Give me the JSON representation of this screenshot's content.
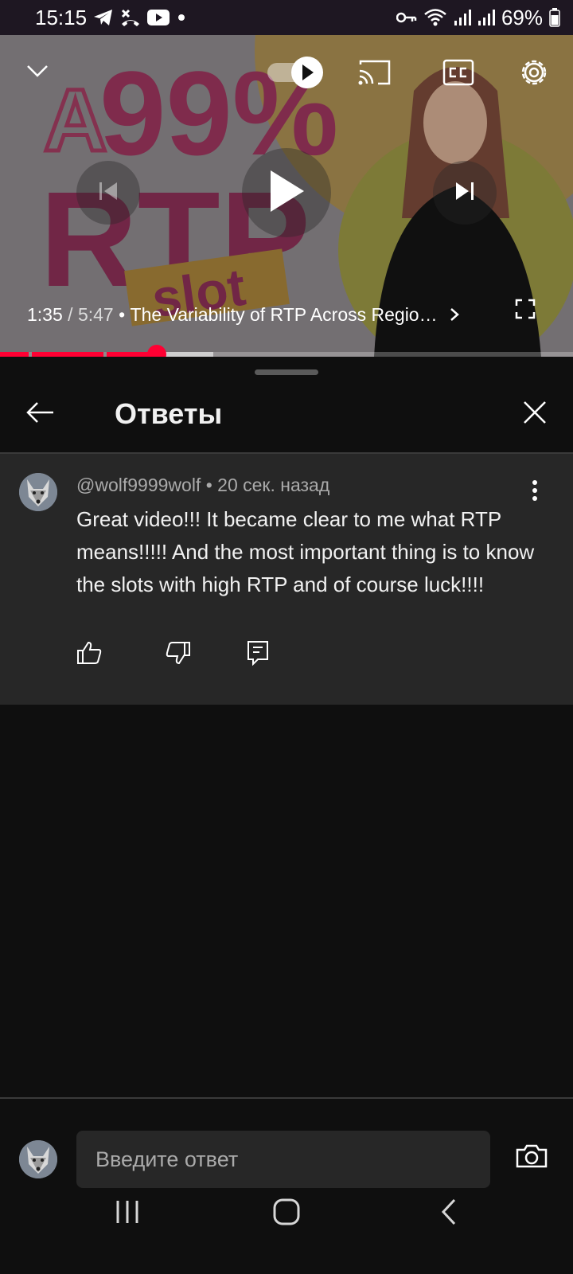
{
  "status_bar": {
    "time": "15:15",
    "battery": "69%",
    "icons": [
      "telegram-icon",
      "missed-call-icon",
      "youtube-icon",
      "dot-icon",
      "vpn-key-icon",
      "wifi-icon",
      "signal-icon",
      "signal-icon",
      "battery-icon"
    ]
  },
  "player": {
    "current_time": "1:35",
    "separator": " / ",
    "duration": "5:47",
    "dot": " • ",
    "chapter": "The Variability of RTP Across Regio…",
    "progress_played": 0.273,
    "progress_buffered": 0.372,
    "icons": [
      "collapse-chevron-icon",
      "autoplay-toggle-icon",
      "cast-icon",
      "captions-icon",
      "settings-gear-icon",
      "previous-icon",
      "play-icon",
      "next-icon",
      "chapter-chevron-icon",
      "fullscreen-icon"
    ],
    "thumbnail_text": [
      "A",
      "99%",
      "RTP",
      "slot"
    ]
  },
  "panel": {
    "title": "Ответы"
  },
  "comment": {
    "author": "@wolf9999wolf",
    "time": "20 сек. назад",
    "meta_sep": " • ",
    "text": "Great video!!! It became clear to me what RTP means!!!!! And the most important thing is to know the slots with high RTP and of course luck!!!!"
  },
  "reply": {
    "placeholder": "Введите ответ"
  },
  "colors": {
    "accent": "#ff0033",
    "background": "#0f0f0f",
    "comment_bg": "#272727",
    "status_bar_bg": "#1e1722"
  }
}
